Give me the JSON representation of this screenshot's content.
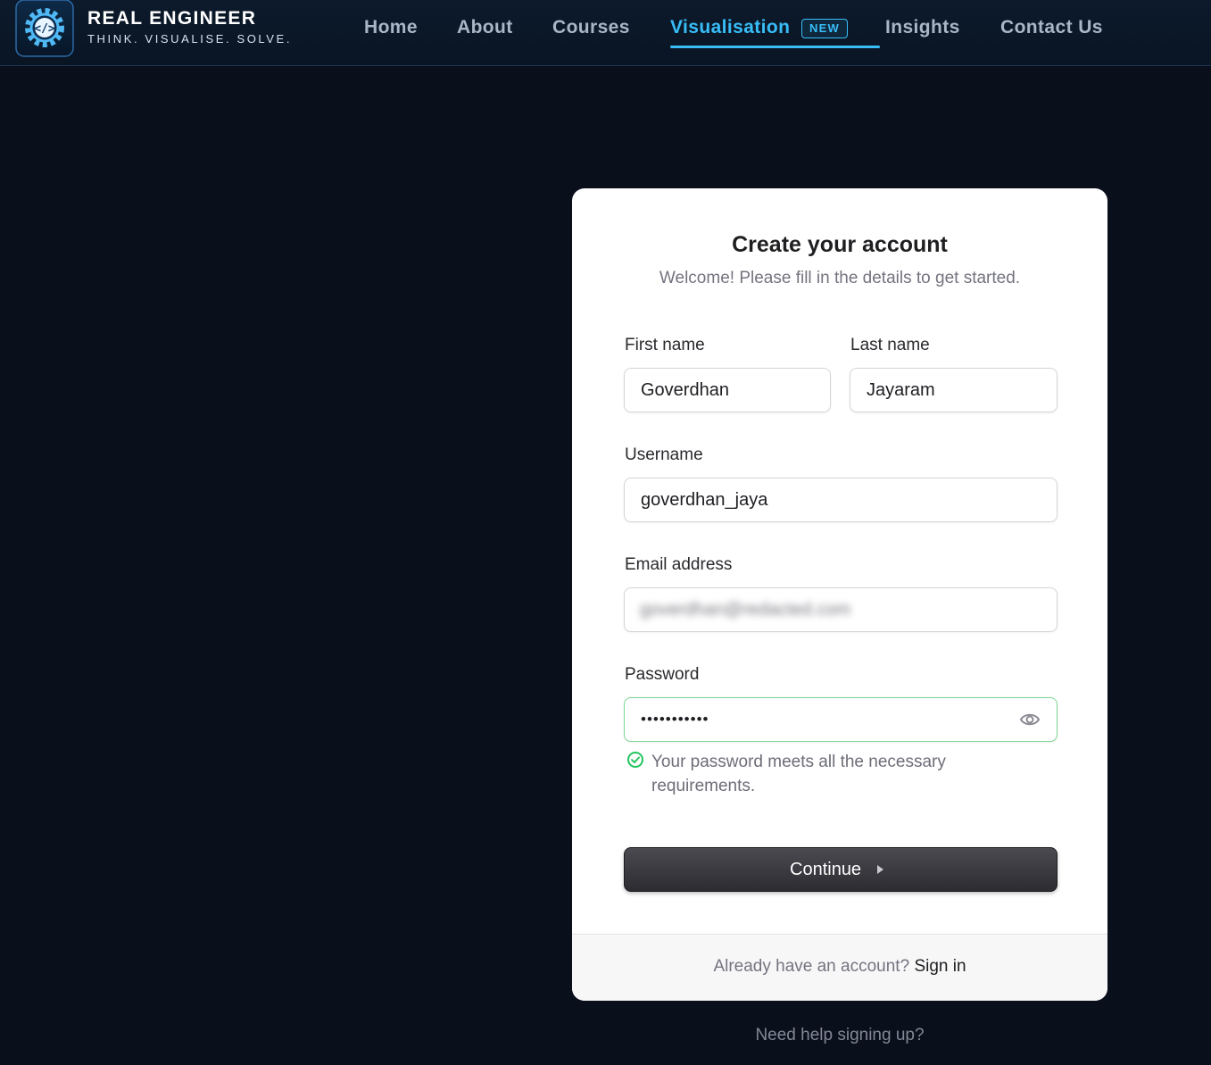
{
  "header": {
    "brand": {
      "name": "REAL ENGINEER",
      "tagline": "THINK. VISUALISE. SOLVE.",
      "logo_icon": "code-gear-icon"
    },
    "nav": [
      {
        "label": "Home",
        "active": false
      },
      {
        "label": "About",
        "active": false
      },
      {
        "label": "Courses",
        "active": false
      },
      {
        "label": "Visualisation",
        "active": true,
        "badge": "NEW"
      },
      {
        "label": "Insights",
        "active": false
      },
      {
        "label": "Contact Us",
        "active": false
      }
    ]
  },
  "signup": {
    "title": "Create your account",
    "subtitle": "Welcome! Please fill in the details to get started.",
    "first_name": {
      "label": "First name",
      "value": "Goverdhan"
    },
    "last_name": {
      "label": "Last name",
      "value": "Jayaram"
    },
    "username": {
      "label": "Username",
      "value": "goverdhan_jaya"
    },
    "email": {
      "label": "Email address",
      "value_obscured": "goverdhan@redacted.com"
    },
    "password": {
      "label": "Password",
      "value_masked": "•••••••••••",
      "validation_message": "Your password meets all the necessary requirements.",
      "toggle_icon": "eye-icon",
      "status_icon": "check-circle-icon"
    },
    "continue_label": "Continue",
    "footer_prompt": "Already have an account?",
    "footer_link": "Sign in"
  },
  "help_link": "Need help signing up?",
  "colors": {
    "page_bg": "#0a0f1c",
    "header_bg": "#0c1a2b",
    "accent": "#38bdf8",
    "nav_text": "#a9b6c6",
    "success": "#22c55e",
    "button_dark": "#2c2c31"
  }
}
